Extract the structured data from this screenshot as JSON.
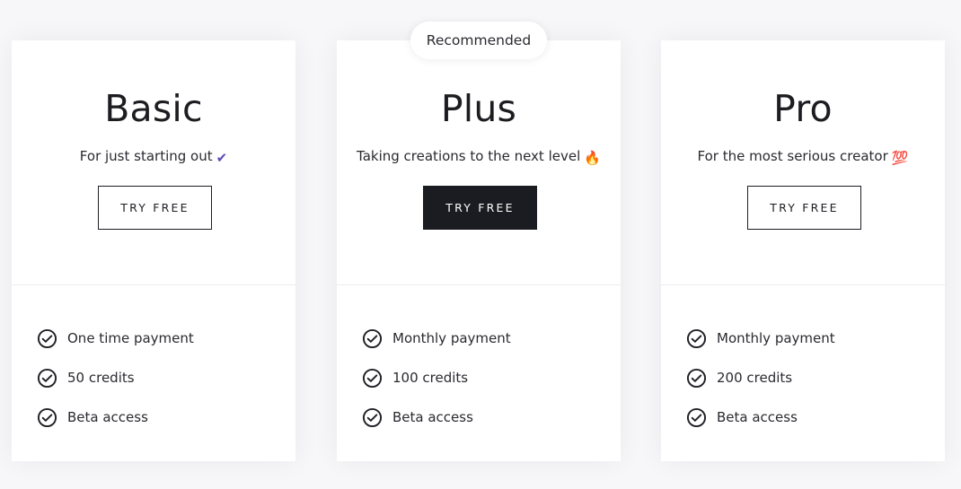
{
  "recommended_badge": "Recommended",
  "plans": [
    {
      "name": "Basic",
      "tagline": "For just starting out",
      "tagline_emoji": "✔",
      "button": "TRY FREE",
      "features": [
        "One time payment",
        "50 credits",
        "Beta access"
      ]
    },
    {
      "name": "Plus",
      "tagline": "Taking creations to the next level",
      "tagline_emoji": "🔥",
      "button": "TRY FREE",
      "features": [
        "Monthly payment",
        "100 credits",
        "Beta access"
      ]
    },
    {
      "name": "Pro",
      "tagline": "For the most serious creator",
      "tagline_emoji": "💯",
      "button": "TRY FREE",
      "features": [
        "Monthly payment",
        "200 credits",
        "Beta access"
      ]
    }
  ],
  "colors": {
    "background": "#f7f7f9",
    "card": "#ffffff",
    "dark_button": "#1b1c21",
    "text": "#1f1f24",
    "check_emoji_color": "#5b4bb5"
  }
}
